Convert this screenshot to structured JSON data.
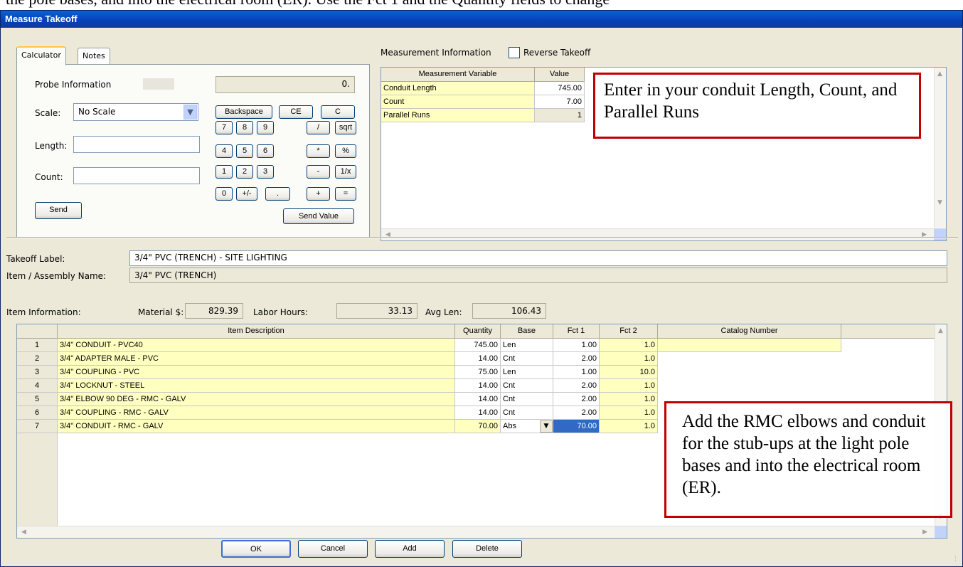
{
  "background_text": "the pole bases, and into the electrical room (ER). Use the Fct 1 and the Quantity fields to change",
  "window": {
    "title": "Measure Takeoff"
  },
  "tabs": {
    "calculator": "Calculator",
    "notes": "Notes"
  },
  "calculator": {
    "probe_label": "Probe Information",
    "display_value": "0.",
    "scale_label": "Scale:",
    "scale_value": "No Scale",
    "length_label": "Length:",
    "count_label": "Count:",
    "send_label": "Send",
    "send_value_label": "Send Value",
    "keys": {
      "backspace": "Backspace",
      "ce": "CE",
      "c": "C",
      "k7": "7",
      "k8": "8",
      "k9": "9",
      "div": "/",
      "sqrt": "sqrt",
      "k4": "4",
      "k5": "5",
      "k6": "6",
      "mul": "*",
      "pct": "%",
      "k1": "1",
      "k2": "2",
      "k3": "3",
      "sub": "-",
      "inv": "1/x",
      "k0": "0",
      "neg": "+/-",
      "dot": ".",
      "add": "+",
      "eq": "="
    }
  },
  "measurement": {
    "section_label": "Measurement Information",
    "reverse_label": "Reverse Takeoff",
    "headers": {
      "variable": "Measurement Variable",
      "value": "Value"
    },
    "rows": [
      {
        "name": "Conduit Length",
        "value": "745.00"
      },
      {
        "name": "Count",
        "value": "7.00"
      },
      {
        "name": "Parallel Runs",
        "value": "1"
      }
    ]
  },
  "callouts": {
    "top": "Enter in your conduit Length, Count, and Parallel Runs",
    "bottom": "Add the RMC elbows and conduit for the stub-ups at the light pole bases and into the electrical room (ER)."
  },
  "takeoff": {
    "label_caption": "Takeoff Label:",
    "label_value": "3/4\" PVC (TRENCH) - SITE LIGHTING",
    "assembly_caption": "Item / Assembly Name:",
    "assembly_value": "3/4\" PVC (TRENCH)"
  },
  "item_info": {
    "caption": "Item Information:",
    "material_label": "Material $:",
    "material_value": "829.39",
    "labor_label": "Labor Hours:",
    "labor_value": "33.13",
    "avg_label": "Avg Len:",
    "avg_value": "106.43"
  },
  "items": {
    "headers": {
      "desc": "Item Description",
      "qty": "Quantity",
      "base": "Base",
      "f1": "Fct 1",
      "f2": "Fct 2",
      "cat": "Catalog Number"
    },
    "rows": [
      {
        "n": "1",
        "desc": "3/4\" CONDUIT - PVC40",
        "qty": "745.00",
        "base": "Len",
        "f1": "1.00",
        "f2": "1.0"
      },
      {
        "n": "2",
        "desc": "3/4\" ADAPTER MALE - PVC",
        "qty": "14.00",
        "base": "Cnt",
        "f1": "2.00",
        "f2": "1.0"
      },
      {
        "n": "3",
        "desc": "3/4\" COUPLING - PVC",
        "qty": "75.00",
        "base": "Len",
        "f1": "1.00",
        "f2": "10.0"
      },
      {
        "n": "4",
        "desc": "3/4\" LOCKNUT - STEEL",
        "qty": "14.00",
        "base": "Cnt",
        "f1": "2.00",
        "f2": "1.0"
      },
      {
        "n": "5",
        "desc": "3/4\" ELBOW 90 DEG - RMC - GALV",
        "qty": "14.00",
        "base": "Cnt",
        "f1": "2.00",
        "f2": "1.0"
      },
      {
        "n": "6",
        "desc": "3/4\" COUPLING - RMC - GALV",
        "qty": "14.00",
        "base": "Cnt",
        "f1": "2.00",
        "f2": "1.0"
      },
      {
        "n": "7",
        "desc": "3/4\" CONDUIT - RMC - GALV",
        "qty": "70.00",
        "base": "Abs",
        "f1": "70.00",
        "f2": "1.0"
      }
    ]
  },
  "buttons": {
    "ok": "OK",
    "cancel": "Cancel",
    "add": "Add",
    "delete": "Delete"
  }
}
